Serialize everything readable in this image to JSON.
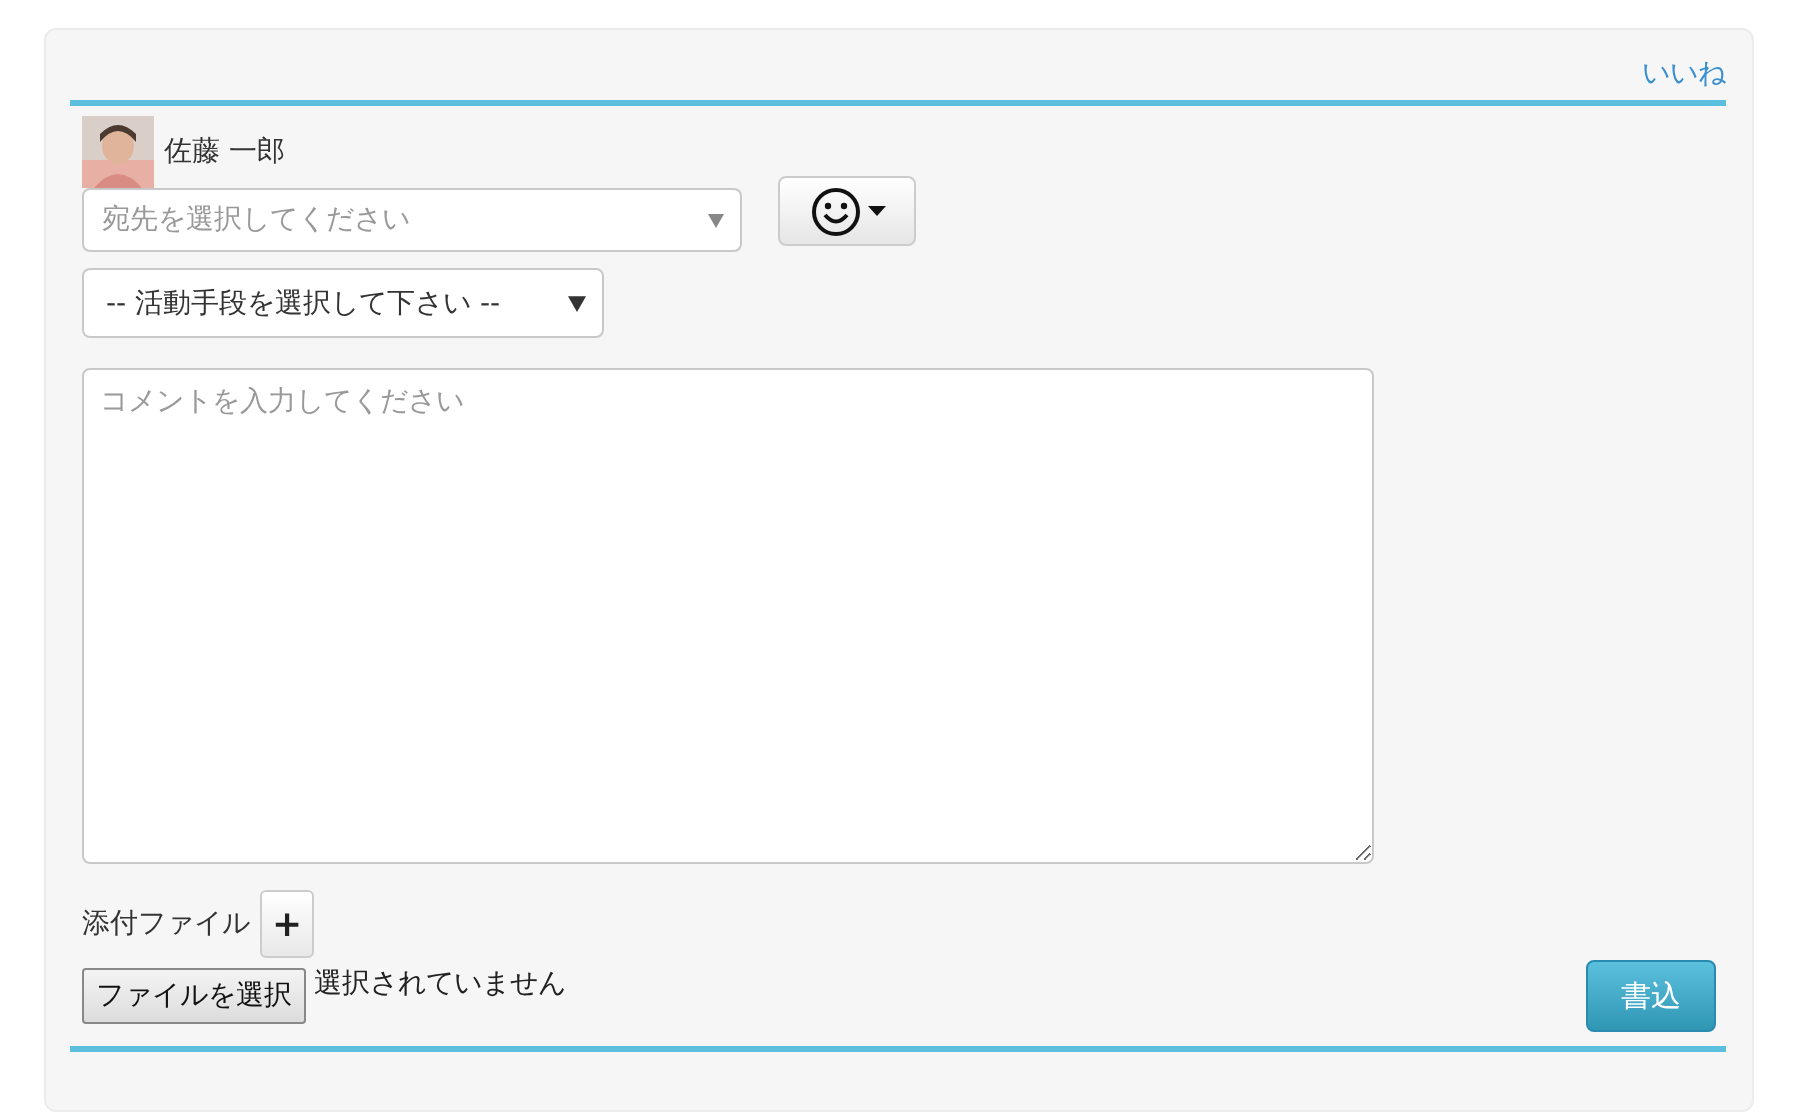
{
  "like_link": "いいね",
  "user": {
    "name": "佐藤 一郎"
  },
  "recipient": {
    "placeholder": "宛先を選択してください"
  },
  "activity_select": {
    "value": "-- 活動手段を選択して下さい --"
  },
  "comment": {
    "placeholder": "コメントを入力してください"
  },
  "attachment": {
    "label": "添付ファイル",
    "add_button": "+"
  },
  "file_input": {
    "button": "ファイルを選択",
    "status": "選択されていません"
  },
  "submit_button": "書込"
}
